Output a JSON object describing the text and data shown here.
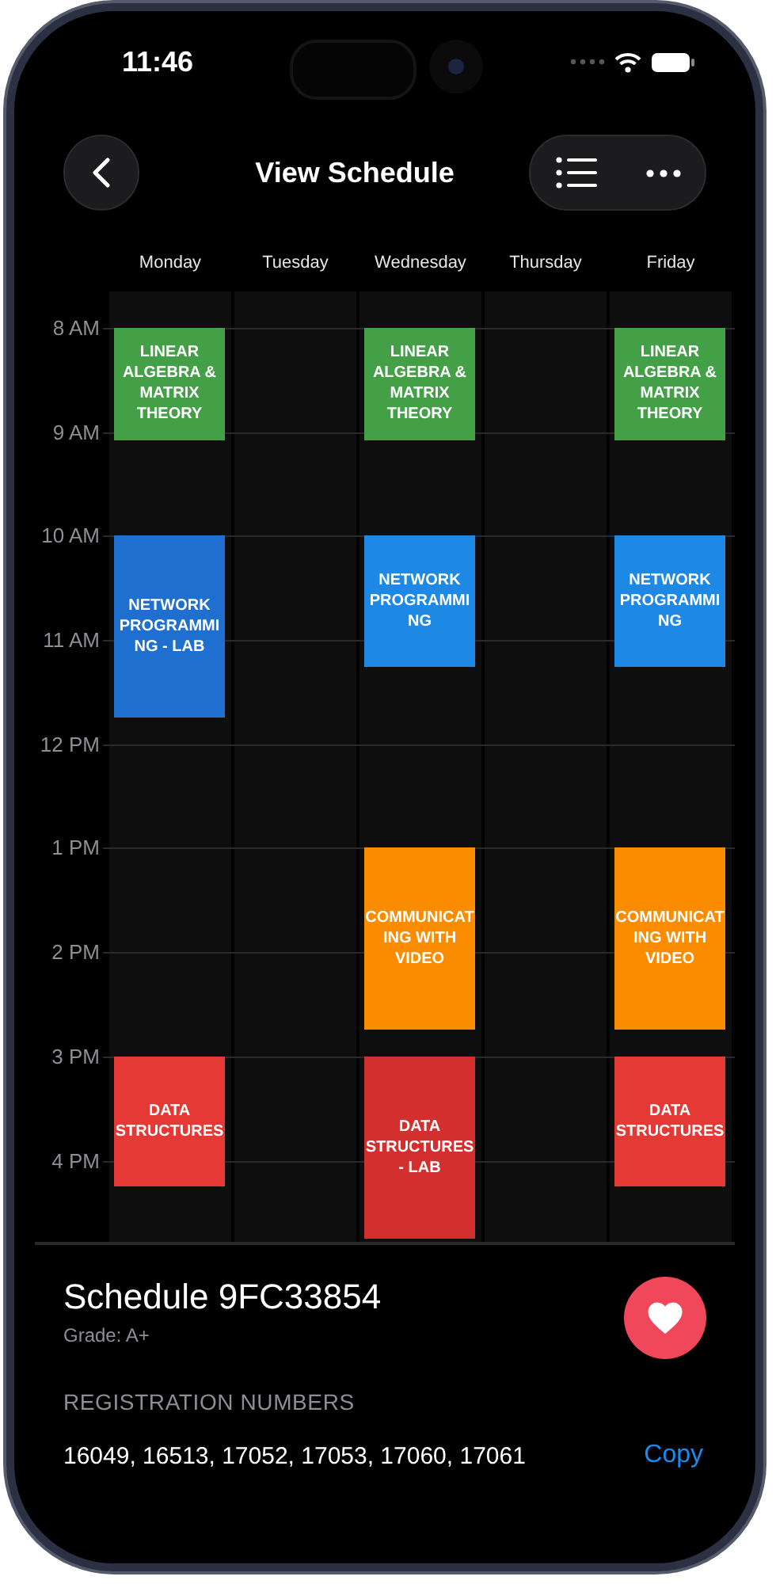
{
  "status_bar": {
    "time": "11:46"
  },
  "header": {
    "title": "View Schedule"
  },
  "days": [
    {
      "label": "Monday"
    },
    {
      "label": "Tuesday"
    },
    {
      "label": "Wednesday"
    },
    {
      "label": "Thursday"
    },
    {
      "label": "Friday"
    }
  ],
  "hours": [
    {
      "label": "8 AM",
      "slots": [
        {
          "kind": "short",
          "title": "LINEAR ALGEBRA & MATRIX THEORY",
          "color": "#43a047"
        },
        {
          "kind": "empty"
        },
        {
          "kind": "short",
          "title": "LINEAR ALGEBRA & MATRIX THEORY",
          "color": "#43a047"
        },
        {
          "kind": "empty"
        },
        {
          "kind": "short",
          "title": "LINEAR ALGEBRA & MATRIX THEORY",
          "color": "#43a047"
        }
      ]
    },
    {
      "label": "9 AM"
    },
    {
      "label": "10 AM",
      "slots": [
        {
          "kind": "long",
          "title": "NETWORK PROGRAMMING - LAB",
          "color": "#1e6fd0"
        },
        {
          "kind": "empty"
        },
        {
          "kind": "standard",
          "title": "NETWORK PROGRAMMING",
          "color": "#1e88e5"
        },
        {
          "kind": "empty"
        },
        {
          "kind": "standard",
          "title": "NETWORK PROGRAMMING",
          "color": "#1e88e5"
        }
      ]
    },
    {
      "label": "11 AM"
    },
    {
      "label": "12 PM"
    },
    {
      "label": "1 PM",
      "slots": [
        {
          "kind": "empty"
        },
        {
          "kind": "empty"
        },
        {
          "kind": "long",
          "title": "COMMUNICATING WITH VIDEO",
          "color": "#fb8c00"
        },
        {
          "kind": "empty"
        },
        {
          "kind": "long",
          "title": "COMMUNICATING WITH VIDEO",
          "color": "#fb8c00"
        }
      ]
    },
    {
      "label": "2 PM"
    },
    {
      "label": "3 PM",
      "slots": [
        {
          "kind": "standard",
          "title": "DATA STRUCTURES",
          "color": "#e53935"
        },
        {
          "kind": "empty"
        },
        {
          "kind": "long",
          "title": "DATA STRUCTURES - LAB",
          "color": "#d32f2f"
        },
        {
          "kind": "empty"
        },
        {
          "kind": "standard",
          "title": "DATA STRUCTURES",
          "color": "#e53935"
        }
      ]
    },
    {
      "label": "4 PM"
    }
  ],
  "details": {
    "title": "Schedule 9FC33854",
    "grade": "Grade: A+",
    "section_heading": "REGISTRATION NUMBERS",
    "registration_numbers": "16049, 16513, 17052, 17053, 17060, 17061",
    "copy_label": "Copy",
    "favorite": true
  }
}
